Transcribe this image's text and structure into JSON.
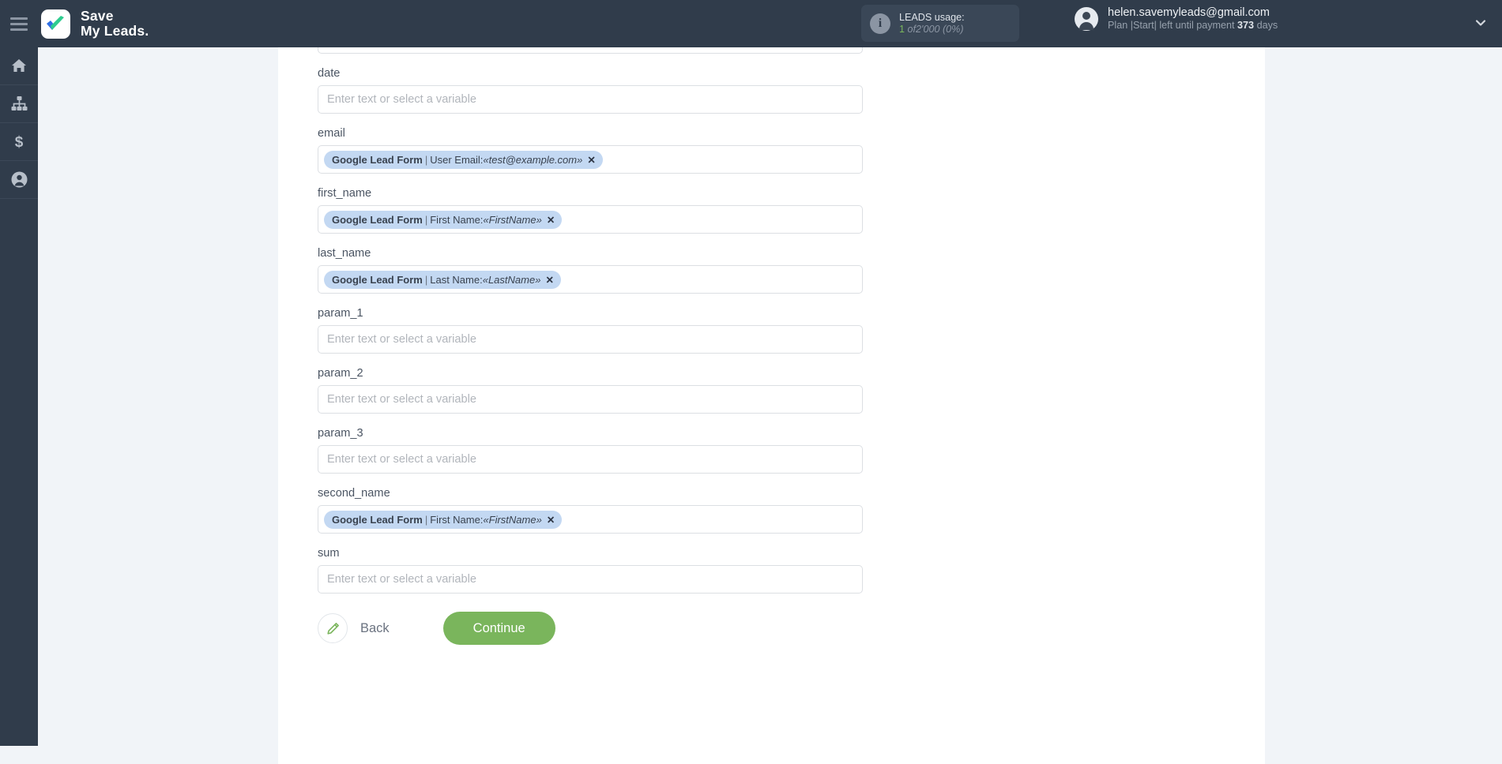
{
  "header": {
    "brand_line1": "Save",
    "brand_line2": "My Leads.",
    "usage": {
      "title": "LEADS usage:",
      "count": "1",
      "of": "of",
      "limit": "2'000",
      "percent": "(0%)"
    },
    "account": {
      "email": "helen.savemyleads@gmail.com",
      "plan_prefix": "Plan |Start| left until payment",
      "days_value": "373",
      "days_suffix": "days"
    }
  },
  "sidebar": {
    "items": [
      {
        "name": "home",
        "label": "Home"
      },
      {
        "name": "connections",
        "label": "Connections"
      },
      {
        "name": "billing",
        "label": "Billing"
      },
      {
        "name": "account",
        "label": "Account"
      }
    ]
  },
  "form": {
    "placeholder": "Enter text or select a variable",
    "fields": [
      {
        "label": "",
        "value": null,
        "partial": true
      },
      {
        "label": "date",
        "value": null
      },
      {
        "label": "email",
        "value": {
          "source": "Google Lead Form",
          "field": "User Email:",
          "variable": "«test@example.com»"
        }
      },
      {
        "label": "first_name",
        "value": {
          "source": "Google Lead Form",
          "field": "First Name:",
          "variable": "«FirstName»"
        }
      },
      {
        "label": "last_name",
        "value": {
          "source": "Google Lead Form",
          "field": "Last Name:",
          "variable": "«LastName»"
        }
      },
      {
        "label": "param_1",
        "value": null
      },
      {
        "label": "param_2",
        "value": null
      },
      {
        "label": "param_3",
        "value": null
      },
      {
        "label": "second_name",
        "value": {
          "source": "Google Lead Form",
          "field": "First Name:",
          "variable": "«FirstName»"
        }
      },
      {
        "label": "sum",
        "value": null
      }
    ],
    "chip_remove": "✕",
    "back_label": "Back",
    "continue_label": "Continue"
  },
  "colors": {
    "header_bg": "#303c4b",
    "page_bg": "#f1f4f8",
    "accent_green": "#7ab55c",
    "chip_blue": "#c3d8f2"
  }
}
